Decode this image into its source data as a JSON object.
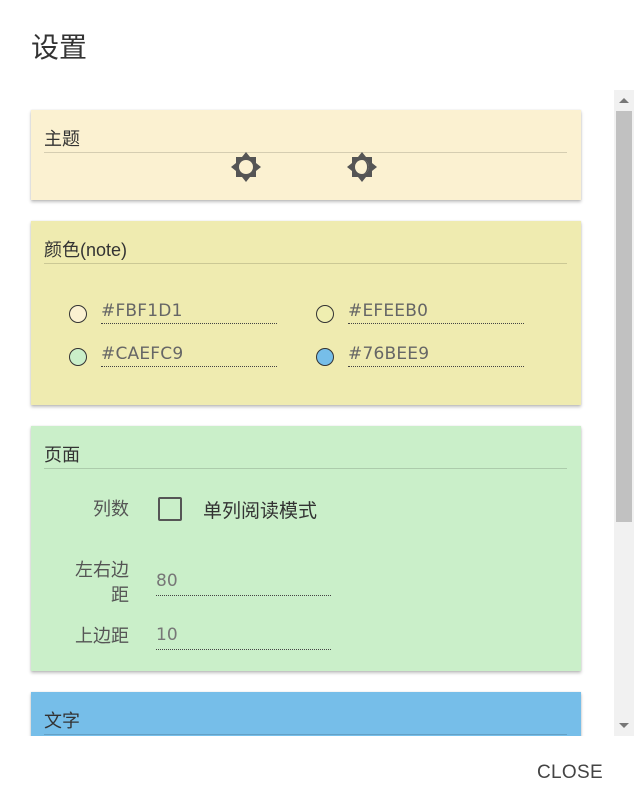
{
  "dialog": {
    "title": "设置",
    "close_label": "CLOSE"
  },
  "theme": {
    "header": "主题",
    "icons": [
      "brightness-light-icon",
      "brightness-dark-icon"
    ]
  },
  "color": {
    "header": "颜色(note)",
    "options": [
      {
        "hex": "#FBF1D1",
        "label": "#FBF1D1",
        "selected": false
      },
      {
        "hex": "#EFEEB0",
        "label": "#EFEEB0",
        "selected": false
      },
      {
        "hex": "#CAEFC9",
        "label": "#CAEFC9",
        "selected": false
      },
      {
        "hex": "#76BEE9",
        "label": "#76BEE9",
        "selected": true
      }
    ]
  },
  "page": {
    "header": "页面",
    "columns_label": "列数",
    "single_column_label": "单列阅读模式",
    "single_column_checked": false,
    "side_margin_label_line1": "左右边",
    "side_margin_label_line2": "距",
    "side_margin_value": "80",
    "top_margin_label": "上边距",
    "top_margin_value": "10"
  },
  "text": {
    "header": "文字"
  },
  "colors": {
    "theme_card_bg": "#FBF1D1",
    "color_card_bg": "#EFEBB0",
    "page_card_bg": "#CAEFC9",
    "text_card_bg": "#76BEE9"
  }
}
